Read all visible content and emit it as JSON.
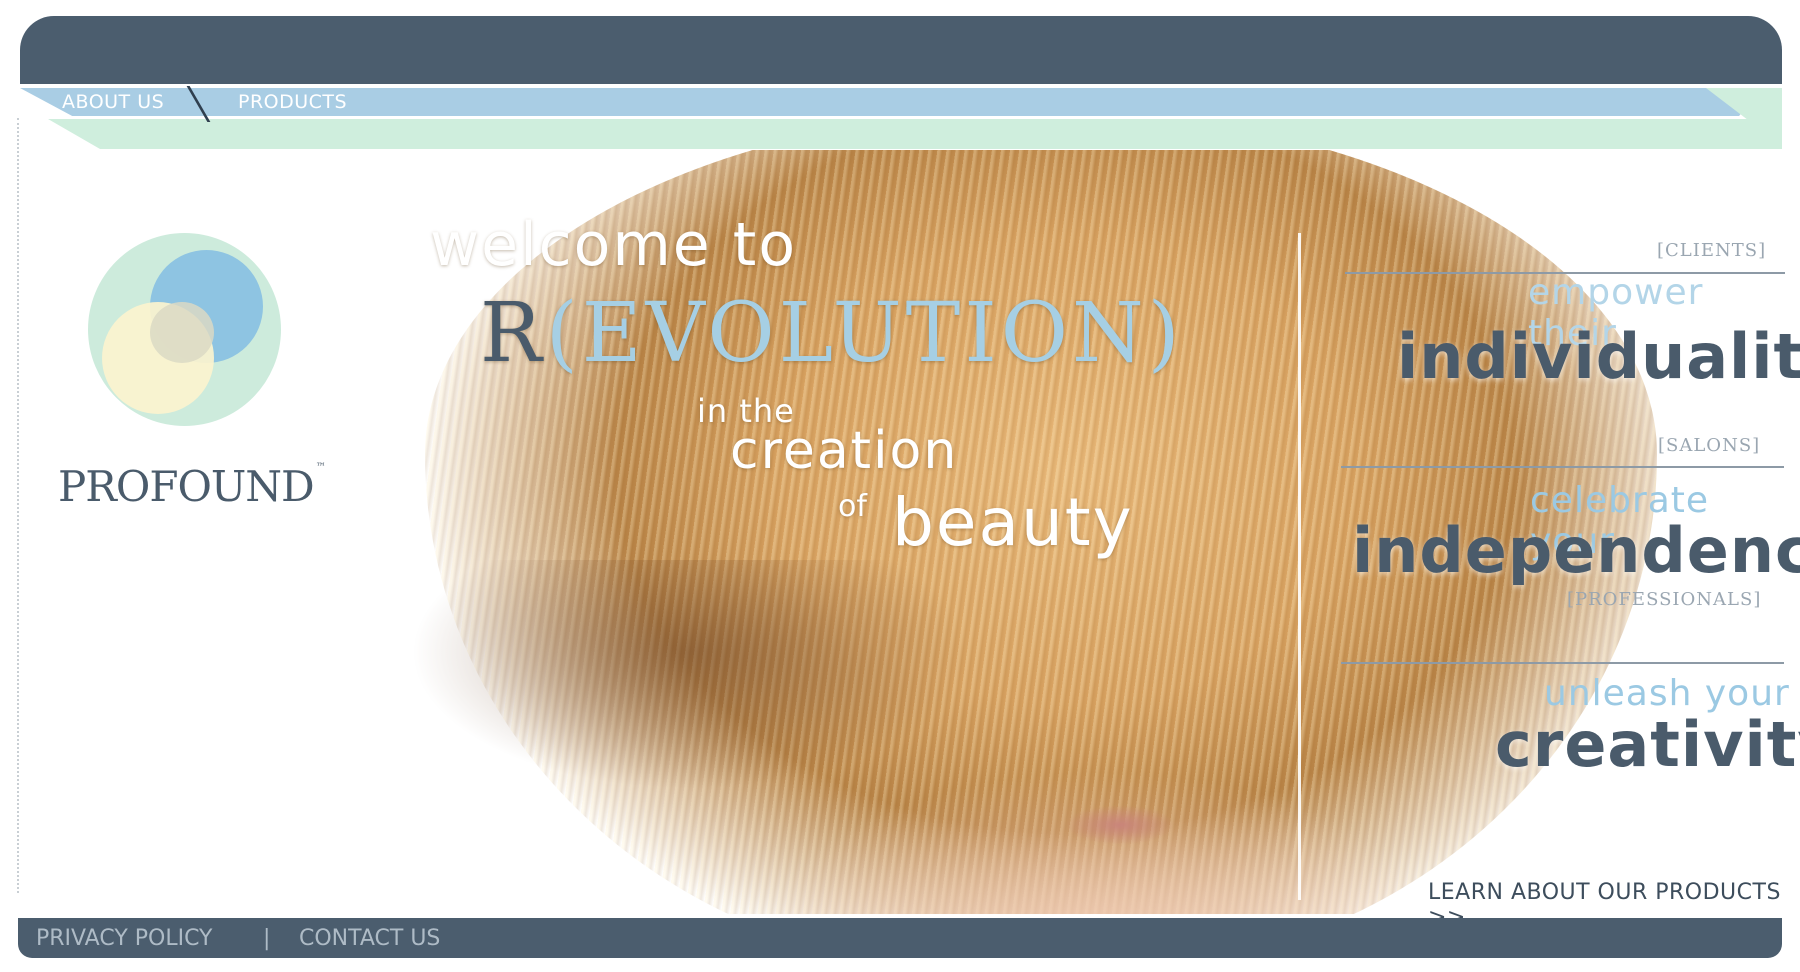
{
  "nav": {
    "about": "ABOUT US",
    "products": "PRODUCTS"
  },
  "brand": {
    "name": "PROFOUND",
    "tm": "™"
  },
  "hero": {
    "welcome": "welcome to",
    "r": "R",
    "evolution": "(EVOLUTION)",
    "in_the": "in the",
    "creation": "creation",
    "of": "of",
    "beauty": "beauty"
  },
  "panels": {
    "clients_tag": "[CLIENTS]",
    "clients_light": "empower their",
    "clients_big": "individuality",
    "salons_tag": "[SALONS]",
    "salons_light": "celebrate your",
    "salons_big": "independence",
    "pros_tag": "[PROFESSIONALS]",
    "pros_light": "unleash your",
    "pros_big": "creativity"
  },
  "cta": {
    "learn": "LEARN ABOUT OUR PRODUCTS >>"
  },
  "footer": {
    "privacy": "PRIVACY POLICY",
    "separator": "|",
    "contact": "CONTACT US"
  },
  "colors": {
    "slate": "#4b5d6e",
    "nav_blue": "#a9cde4",
    "nav_green": "#cfeedd",
    "accent_blue": "#9bc9e3"
  }
}
